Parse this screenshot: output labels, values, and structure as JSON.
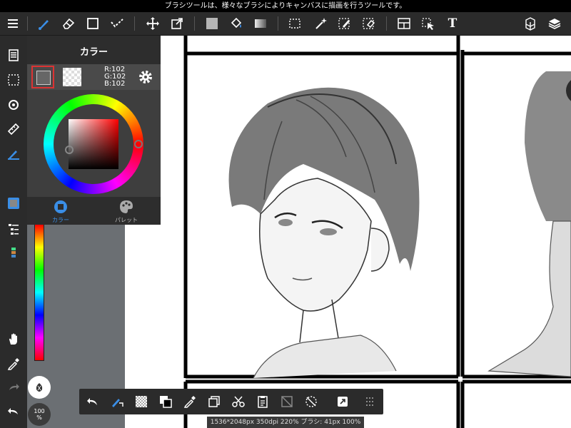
{
  "status_bar": {
    "text": "ブラシツールは、様々なブラシによりキャンバスに描画を行うツールです。"
  },
  "toolbar": {
    "tools": [
      "menu-icon",
      "brush-icon",
      "eraser-icon",
      "rect-icon",
      "dots-icon",
      "move-icon",
      "transform-icon",
      "fill-color-icon",
      "bucket-icon",
      "gradient-icon",
      "select-icon",
      "magic-wand-icon",
      "select-pen-icon",
      "select-eraser-icon",
      "frame-icon",
      "select-arrow-icon",
      "text-icon",
      "material-icon",
      "layer-icon"
    ],
    "text_tool_label": "T"
  },
  "color_panel": {
    "title": "カラー",
    "rgb": {
      "r": "R:102",
      "g": "G:102",
      "b": "B:102"
    },
    "main_color": "#666666",
    "tabs": {
      "color": "カラー",
      "palette": "パレット"
    }
  },
  "zoom": {
    "value": "100",
    "unit": "%"
  },
  "canvas_info": "1536*2048px 350dpi 220% ブラシ: 41px 100%",
  "colors": {
    "accent": "#3a8ee6",
    "toolbar_bg": "#2b2b2b",
    "canvas_bg": "#6b6f73"
  }
}
